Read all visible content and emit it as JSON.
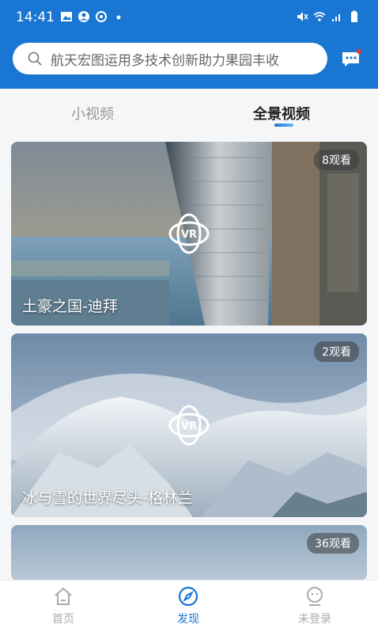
{
  "status": {
    "time": "14:41"
  },
  "search": {
    "text": "航天宏图运用多技术创新助力果园丰收"
  },
  "tabs": {
    "short_video": "小视频",
    "panorama_video": "全景视频"
  },
  "videos": [
    {
      "title": "土豪之国-迪拜",
      "views": "8观看"
    },
    {
      "title": "冰与雪的世界尽头-格林兰",
      "views": "2观看"
    },
    {
      "title": "",
      "views": "36观看"
    }
  ],
  "vr_label": "VR",
  "nav": {
    "home": "首页",
    "discover": "发现",
    "login": "未登录"
  },
  "colors": {
    "brand": "#1976d2",
    "inactive": "#aaaaaa"
  }
}
